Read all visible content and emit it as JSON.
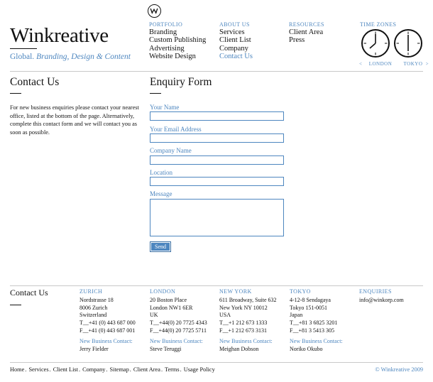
{
  "header": {
    "brand": "Winkreative",
    "tagline_prefix": "Global.",
    "tagline_rest": "Branding, Design & Content"
  },
  "nav": [
    {
      "title": "PORTFOLIO",
      "items": [
        "Branding",
        "Custom Publishing",
        "Advertising",
        "Website Design"
      ]
    },
    {
      "title": "ABOUT US",
      "items": [
        "Services",
        "Client List",
        "Company",
        "Contact Us"
      ]
    },
    {
      "title": "RESOURCES",
      "items": [
        "Client Area",
        "Press"
      ]
    }
  ],
  "timezones": {
    "title": "TIME ZONES",
    "prev": "<",
    "next": ">",
    "london": "LONDON",
    "tokyo": "TOKYO"
  },
  "contact": {
    "heading": "Contact Us",
    "intro": "For new business enquiries please contact your nearest office, listed at the bottom of the page. Alternatively, complete this contact form and we will contact you as soon as possible."
  },
  "form": {
    "heading": "Enquiry Form",
    "labels": {
      "name": "Your Name",
      "email": "Your Email Address",
      "company": "Company Name",
      "location": "Location",
      "message": "Message"
    },
    "send": "Send"
  },
  "footer": {
    "heading": "Contact Us",
    "offices": [
      {
        "city": "ZURICH",
        "address": [
          "Nordstrasse 18",
          "8006 Zurich",
          "Switzerland"
        ],
        "tel": "T__+41 (0) 443 687 000",
        "fax": "F__+41 (0) 443 687 001",
        "nbc_label": "New Business Contact:",
        "nbc_name": "Jerry Fielder"
      },
      {
        "city": "LONDON",
        "address": [
          "20 Boston Place",
          "London NW1 6ER",
          "UK"
        ],
        "tel": "T__+44(0) 20 7725 4343",
        "fax": "F__+44(0) 20 7725 5711",
        "nbc_label": "New Business Contact:",
        "nbc_name": "Steve Teruggi"
      },
      {
        "city": "NEW YORK",
        "address": [
          "611 Broadway, Suite 632",
          "New York NY 10012",
          "USA"
        ],
        "tel": "T__+1 212 673 1333",
        "fax": "F__+1 212 673 3131",
        "nbc_label": "New Business Contact:",
        "nbc_name": "Meighan Dobson"
      },
      {
        "city": "TOKYO",
        "address": [
          "4-12-8 Sendagaya",
          "Tokyo 151-0051",
          "Japan"
        ],
        "tel": "T__+81 3 6825 3201",
        "fax": "F__+81 3 5413 305",
        "nbc_label": "New Business Contact:",
        "nbc_name": "Noriko Okubo"
      }
    ],
    "enquiries": {
      "title": "ENQUIRIES",
      "email": "info@winkorp.com"
    },
    "links": [
      "Home",
      "Services",
      "Client List",
      "Company",
      "Sitemap",
      "Client Area",
      "Terms",
      "Usage Policy"
    ],
    "copyright": "© Winkreative 2009"
  },
  "colors": {
    "accent": "#4d86bf",
    "text": "#111111",
    "rule": "#c9c9c9"
  }
}
